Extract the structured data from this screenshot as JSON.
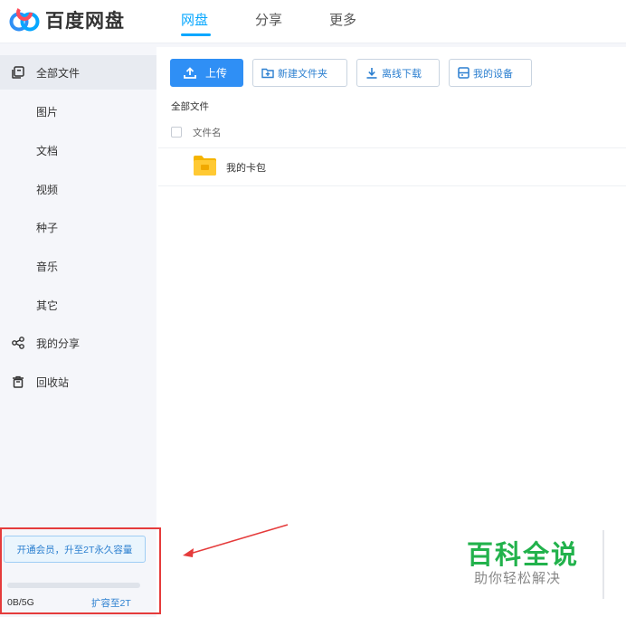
{
  "app": {
    "name": "百度网盘",
    "nav": [
      {
        "label": "网盘",
        "active": true
      },
      {
        "label": "分享",
        "active": false
      },
      {
        "label": "更多",
        "active": false
      }
    ],
    "accent_color": "#06a7ff"
  },
  "sidebar": {
    "items": [
      {
        "label": "全部文件",
        "icon": "files-icon",
        "active": true
      },
      {
        "label": "图片"
      },
      {
        "label": "文档"
      },
      {
        "label": "视频"
      },
      {
        "label": "种子"
      },
      {
        "label": "音乐"
      },
      {
        "label": "其它"
      },
      {
        "label": "我的分享",
        "icon": "share-icon"
      },
      {
        "label": "回收站",
        "icon": "trash-icon"
      }
    ],
    "promo_label": "开通会员，升至2T永久容量",
    "quota_text": "0B/5G",
    "quota_used_fraction": 0,
    "expand_label": "扩容至2T"
  },
  "toolbar": {
    "upload_label": "上传",
    "new_folder_label": "新建文件夹",
    "offline_download_label": "离线下载",
    "my_devices_label": "我的设备"
  },
  "main": {
    "breadcrumb": "全部文件",
    "column_filename": "文件名",
    "files": [
      {
        "name": "我的卡包",
        "type": "folder"
      }
    ]
  },
  "watermark": {
    "title": "百科全说",
    "subtitle": "助你轻松解决"
  }
}
